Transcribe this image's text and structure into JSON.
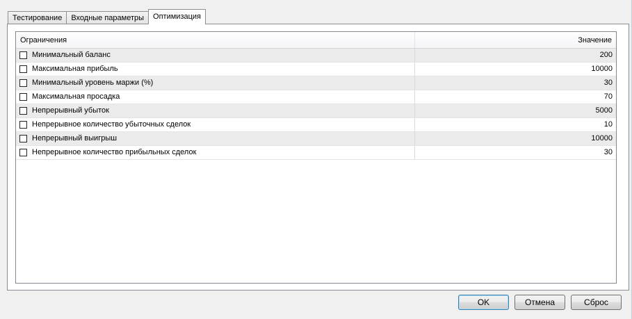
{
  "tabs": [
    {
      "label": "Тестирование",
      "active": false
    },
    {
      "label": "Входные параметры",
      "active": false
    },
    {
      "label": "Оптимизация",
      "active": true
    }
  ],
  "grid": {
    "columns": [
      "Ограничения",
      "Значение"
    ],
    "rows": [
      {
        "label": "Минимальный баланс",
        "value": "200",
        "checked": false
      },
      {
        "label": "Максимальная прибыль",
        "value": "10000",
        "checked": false
      },
      {
        "label": "Минимальный уровень маржи (%)",
        "value": "30",
        "checked": false
      },
      {
        "label": "Максимальная просадка",
        "value": "70",
        "checked": false
      },
      {
        "label": "Непрерывный убыток",
        "value": "5000",
        "checked": false
      },
      {
        "label": "Непрерывное количество убыточных сделок",
        "value": "10",
        "checked": false
      },
      {
        "label": "Непрерывный выигрыш",
        "value": "10000",
        "checked": false
      },
      {
        "label": "Непрерывное количество прибыльных сделок",
        "value": "30",
        "checked": false
      }
    ]
  },
  "buttons": {
    "ok": "OK",
    "cancel": "Отмена",
    "reset": "Сброс"
  }
}
